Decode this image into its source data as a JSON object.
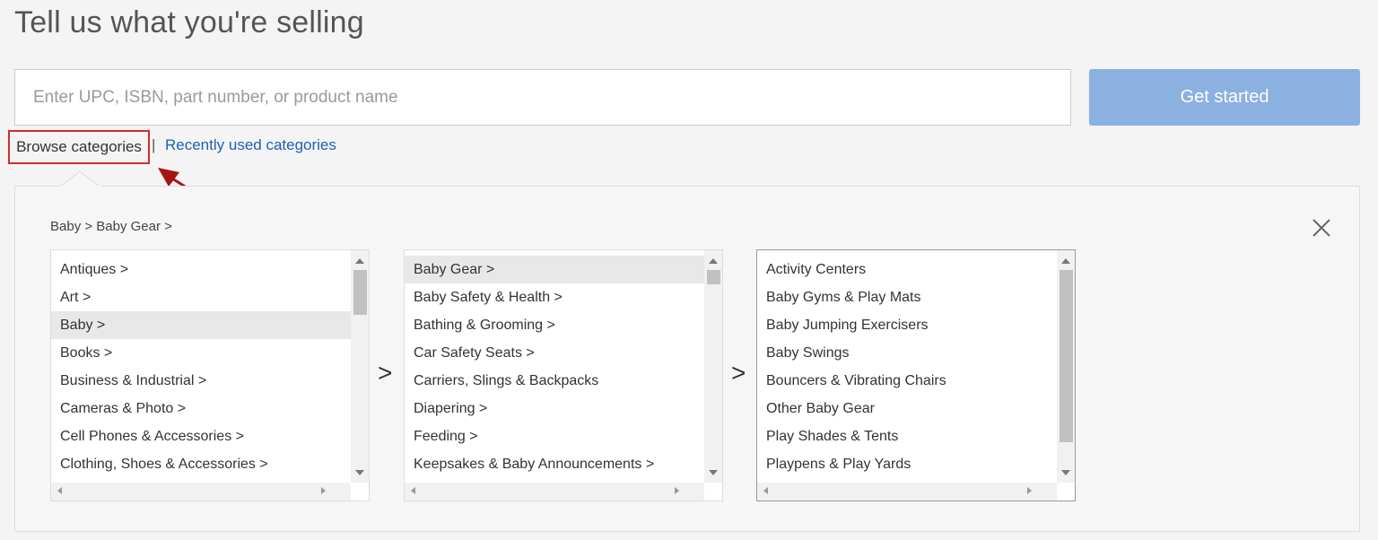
{
  "header": {
    "title": "Tell us what you're selling"
  },
  "search": {
    "placeholder": "Enter UPC, ISBN, part number, or product name",
    "button_label": "Get started"
  },
  "links": {
    "browse": "Browse categories",
    "separator": "|",
    "recent": "Recently used categories"
  },
  "panel": {
    "breadcrumb": "Baby > Baby Gear >",
    "column_separator": ">",
    "columns": [
      {
        "items": [
          "Antiques >",
          "Art >",
          "Baby >",
          "Books >",
          "Business & Industrial >",
          "Cameras & Photo >",
          "Cell Phones & Accessories >",
          "Clothing, Shoes & Accessories >"
        ],
        "selected": "Baby >"
      },
      {
        "items": [
          "Baby Gear >",
          "Baby Safety & Health >",
          "Bathing & Grooming >",
          "Car Safety Seats >",
          "Carriers, Slings & Backpacks",
          "Diapering >",
          "Feeding >",
          "Keepsakes & Baby Announcements >"
        ],
        "selected": "Baby Gear >"
      },
      {
        "items": [
          "Activity Centers",
          "Baby Gyms & Play Mats",
          "Baby Jumping Exercisers",
          "Baby Swings",
          "Bouncers & Vibrating Chairs",
          "Other Baby Gear",
          "Play Shades & Tents",
          "Playpens & Play Yards"
        ],
        "selected": ""
      }
    ]
  },
  "colors": {
    "accent_button": "#8ab1e0",
    "link": "#1f5fb4",
    "annotation": "#d42b2b"
  }
}
